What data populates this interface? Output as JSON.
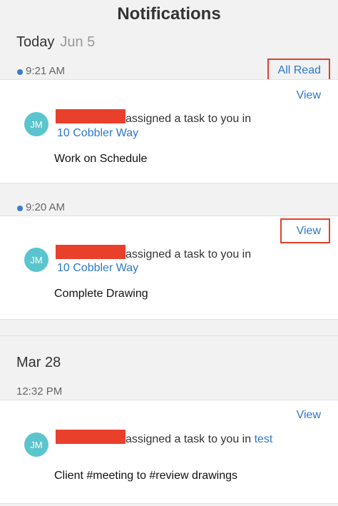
{
  "header": {
    "title": "Notifications"
  },
  "sections": [
    {
      "heading": "Today",
      "date": "Jun 5",
      "mark_all_read": "All Read",
      "notifications": [
        {
          "time": "9:21 AM",
          "unread": true,
          "view_label": "View",
          "avatar": "JM",
          "action": "assigned a task to you in",
          "project": "10 Cobbler Way",
          "task": "Work on Schedule"
        },
        {
          "time": "9:20 AM",
          "unread": true,
          "view_label": "View",
          "avatar": "JM",
          "action": "assigned a task to you in",
          "project": "10 Cobbler Way",
          "task": "Complete Drawing"
        }
      ]
    },
    {
      "heading": "Mar 28",
      "notifications": [
        {
          "time": "12:32 PM",
          "unread": false,
          "view_label": "View",
          "avatar": "JM",
          "action": "assigned a task to you in",
          "project": "test",
          "task": "Client #meeting to #review drawings"
        }
      ]
    }
  ],
  "colors": {
    "accent": "#2e78c9",
    "unread_dot": "#3b7bd4",
    "avatar_bg": "#5bc5cd",
    "redaction": "#e9402c",
    "highlight": "#e2402c"
  }
}
